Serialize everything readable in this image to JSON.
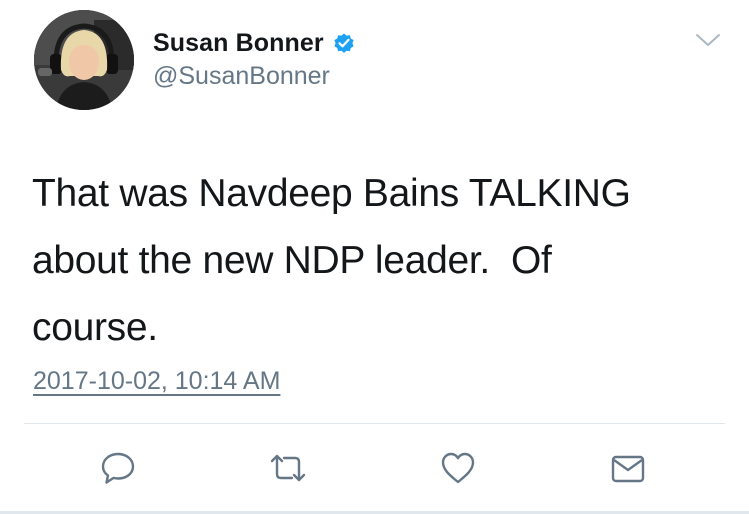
{
  "author": {
    "display_name": "Susan Bonner",
    "handle": "@SusanBonner",
    "verified": true,
    "verified_color": "#1da1f2"
  },
  "tweet": {
    "text": "That was Navdeep Bains TALKING\nabout the new NDP leader.  Of\ncourse.",
    "timestamp": "2017-10-02, 10:14 AM"
  },
  "actions": [
    {
      "name": "reply",
      "icon": "speech-bubble-icon"
    },
    {
      "name": "retweet",
      "icon": "retweet-icon"
    },
    {
      "name": "like",
      "icon": "heart-icon"
    },
    {
      "name": "direct-message",
      "icon": "envelope-icon"
    }
  ],
  "colors": {
    "text_primary": "#14171a",
    "text_secondary": "#657786",
    "divider": "#e1e8ed",
    "icon": "#657786"
  }
}
